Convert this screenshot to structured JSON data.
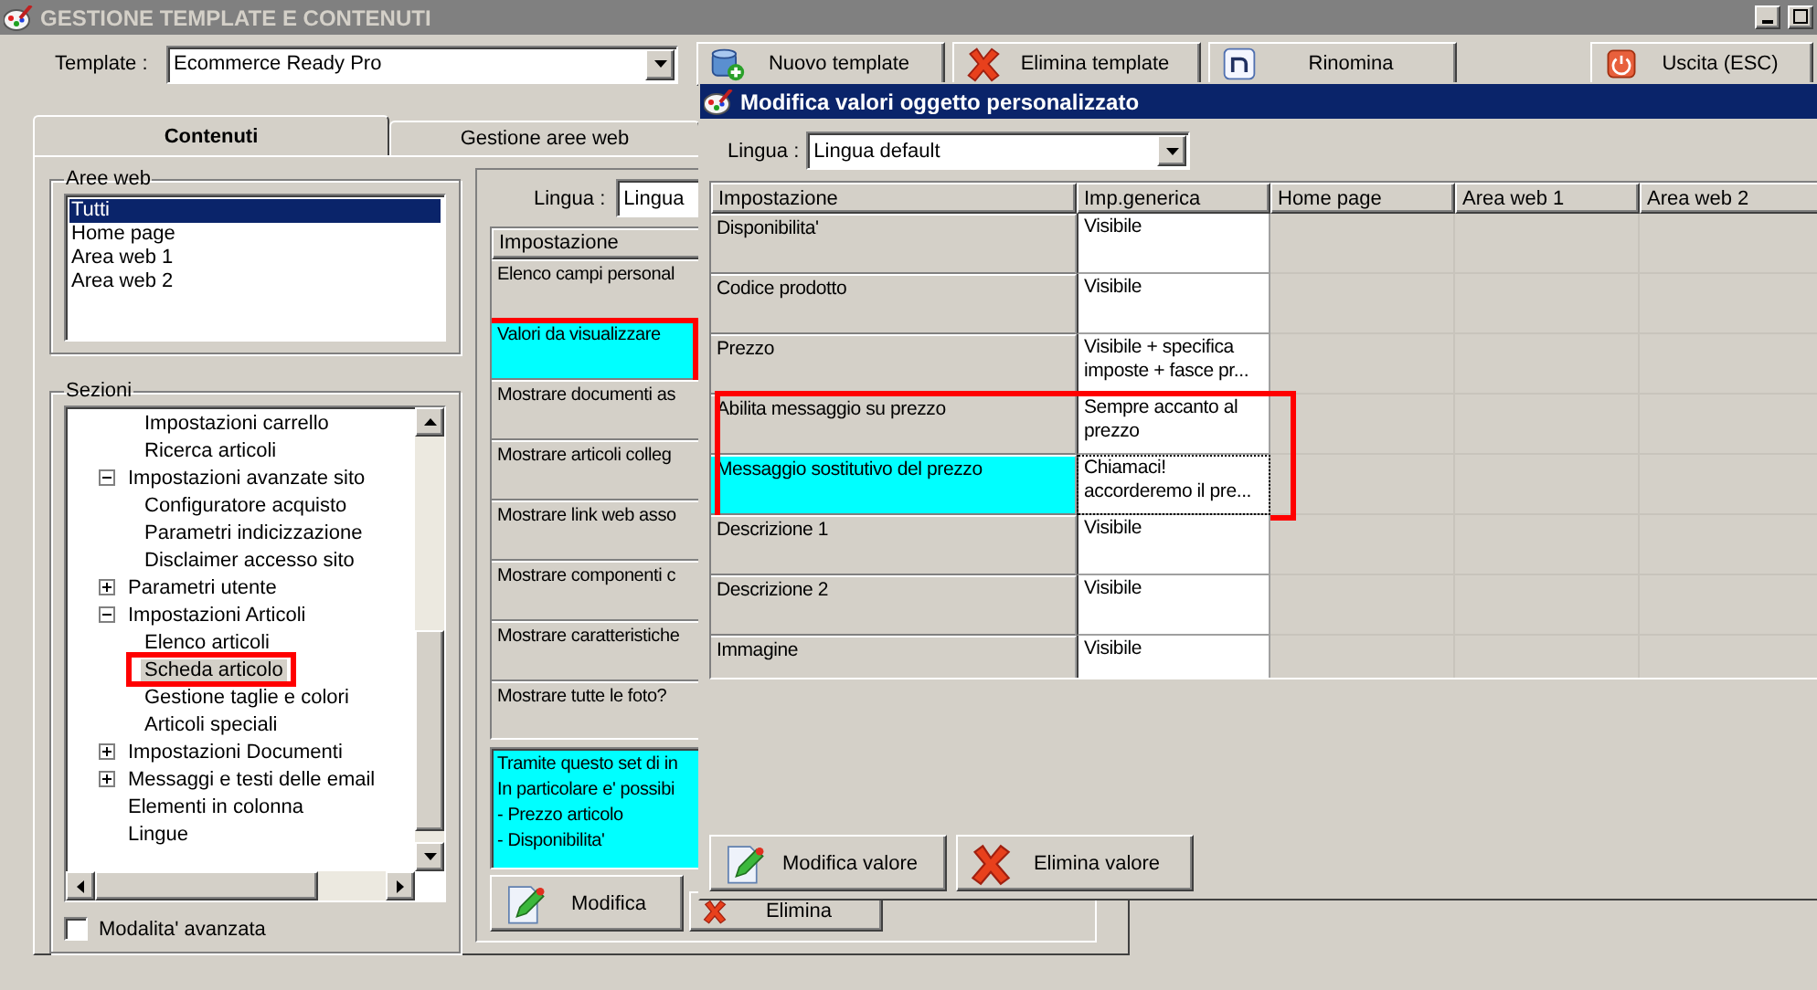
{
  "window": {
    "title": "GESTIONE TEMPLATE E CONTENUTI"
  },
  "template": {
    "label": "Template :",
    "value": "Ecommerce Ready Pro"
  },
  "toolbar": [
    {
      "kind": "new",
      "label": "Nuovo template"
    },
    {
      "kind": "delete",
      "label": "Elimina template"
    },
    {
      "kind": "rename",
      "label": "Rinomina"
    },
    {
      "kind": "exit",
      "label": "Uscita (ESC)"
    }
  ],
  "tabs": [
    {
      "label": "Contenuti",
      "selected": true
    },
    {
      "label": "Gestione aree web",
      "selected": false
    }
  ],
  "web_areas": {
    "title": "Aree web",
    "items": [
      {
        "label": "Tutti",
        "selected": true
      },
      {
        "label": "Home page",
        "selected": false
      },
      {
        "label": "Area web 1",
        "selected": false
      },
      {
        "label": "Area web 2",
        "selected": false
      }
    ]
  },
  "sections": {
    "title": "Sezioni",
    "tree": [
      {
        "children": [
          {
            "label": "Impostazioni carrello",
            "selected": false,
            "annotated": false
          },
          {
            "label": "Ricerca articoli",
            "selected": false,
            "annotated": false
          }
        ]
      },
      {
        "label": "Impostazioni avanzate sito",
        "expanded": true,
        "selected": false,
        "annotated": false,
        "children": [
          {
            "label": "Configuratore acquisto",
            "selected": false,
            "annotated": false
          },
          {
            "label": "Parametri indicizzazione",
            "selected": false,
            "annotated": false
          },
          {
            "label": "Disclaimer accesso sito",
            "selected": false,
            "annotated": false
          }
        ]
      },
      {
        "label": "Parametri utente",
        "expanded": false,
        "selected": false,
        "annotated": false
      },
      {
        "label": "Impostazioni Articoli",
        "expanded": true,
        "selected": false,
        "annotated": false,
        "children": [
          {
            "label": "Elenco articoli",
            "selected": false,
            "annotated": false
          },
          {
            "label": "Scheda articolo",
            "selected": true,
            "annotated": true
          },
          {
            "label": "Gestione taglie e colori",
            "selected": false,
            "annotated": false
          },
          {
            "label": "Articoli speciali",
            "selected": false,
            "annotated": false
          }
        ]
      },
      {
        "label": "Impostazioni Documenti",
        "expanded": false,
        "selected": false,
        "annotated": false
      },
      {
        "label": "Messaggi e testi delle email",
        "expanded": false,
        "selected": false,
        "annotated": false
      },
      {
        "label": "Elementi in colonna",
        "selected": false,
        "annotated": false
      },
      {
        "label": "Lingue",
        "selected": false,
        "annotated": false
      }
    ],
    "advanced_mode": {
      "label": "Modalita' avanzata",
      "checked": false
    }
  },
  "settings_panel": {
    "language_label": "Lingua :",
    "language_value": "Lingua",
    "column": "Impostazione",
    "rows": [
      {
        "label": "Elenco campi personal",
        "selected": false,
        "annotated": false
      },
      {
        "label": "Valori da visualizzare",
        "selected": true,
        "annotated": true
      },
      {
        "label": "Mostrare documenti as",
        "selected": false,
        "annotated": false
      },
      {
        "label": "Mostrare articoli colleg",
        "selected": false,
        "annotated": false
      },
      {
        "label": "Mostrare link web asso",
        "selected": false,
        "annotated": false
      },
      {
        "label": "Mostrare componenti c",
        "selected": false,
        "annotated": false
      },
      {
        "label": "Mostrare caratteristiche",
        "selected": false,
        "annotated": false
      },
      {
        "label": "Mostrare tutte le foto?",
        "selected": false,
        "annotated": false
      }
    ],
    "info": [
      "Tramite questo set di in",
      "In particolare e' possibi",
      "- Prezzo articolo",
      "- Disponibilita'"
    ],
    "buttons": [
      {
        "kind": "edit",
        "label": "Modifica"
      },
      {
        "kind": "delete",
        "label": "Elimina"
      }
    ]
  },
  "dialog": {
    "title": "Modifica valori oggetto personalizzato",
    "language_label": "Lingua :",
    "language_value": "Lingua default",
    "columns": [
      "Impostazione",
      "Imp.generica",
      "Home page",
      "Area web 1",
      "Area web 2"
    ],
    "rows": [
      {
        "setting": "Disponibilita'",
        "generic": "Visibile",
        "selected": false,
        "annotated": false
      },
      {
        "setting": "Codice prodotto",
        "generic": "Visibile",
        "selected": false,
        "annotated": false
      },
      {
        "setting": "Prezzo",
        "generic": "Visibile + specifica imposte + fasce pr...",
        "selected": false,
        "annotated": false
      },
      {
        "setting": "Abilita messaggio su prezzo",
        "generic": "Sempre accanto al prezzo",
        "selected": false,
        "annotated": true
      },
      {
        "setting": "Messaggio sostitutivo del prezzo",
        "generic": "Chiamaci! accorderemo il pre...",
        "selected": true,
        "annotated": true
      },
      {
        "setting": "Descrizione 1",
        "generic": "Visibile",
        "selected": false,
        "annotated": false
      },
      {
        "setting": "Descrizione 2",
        "generic": "Visibile",
        "selected": false,
        "annotated": false
      },
      {
        "setting": "Immagine",
        "generic": "Visibile",
        "selected": false,
        "annotated": false
      }
    ],
    "buttons": [
      {
        "kind": "edit",
        "label": "Modifica valore"
      },
      {
        "kind": "delete",
        "label": "Elimina valore"
      }
    ]
  }
}
